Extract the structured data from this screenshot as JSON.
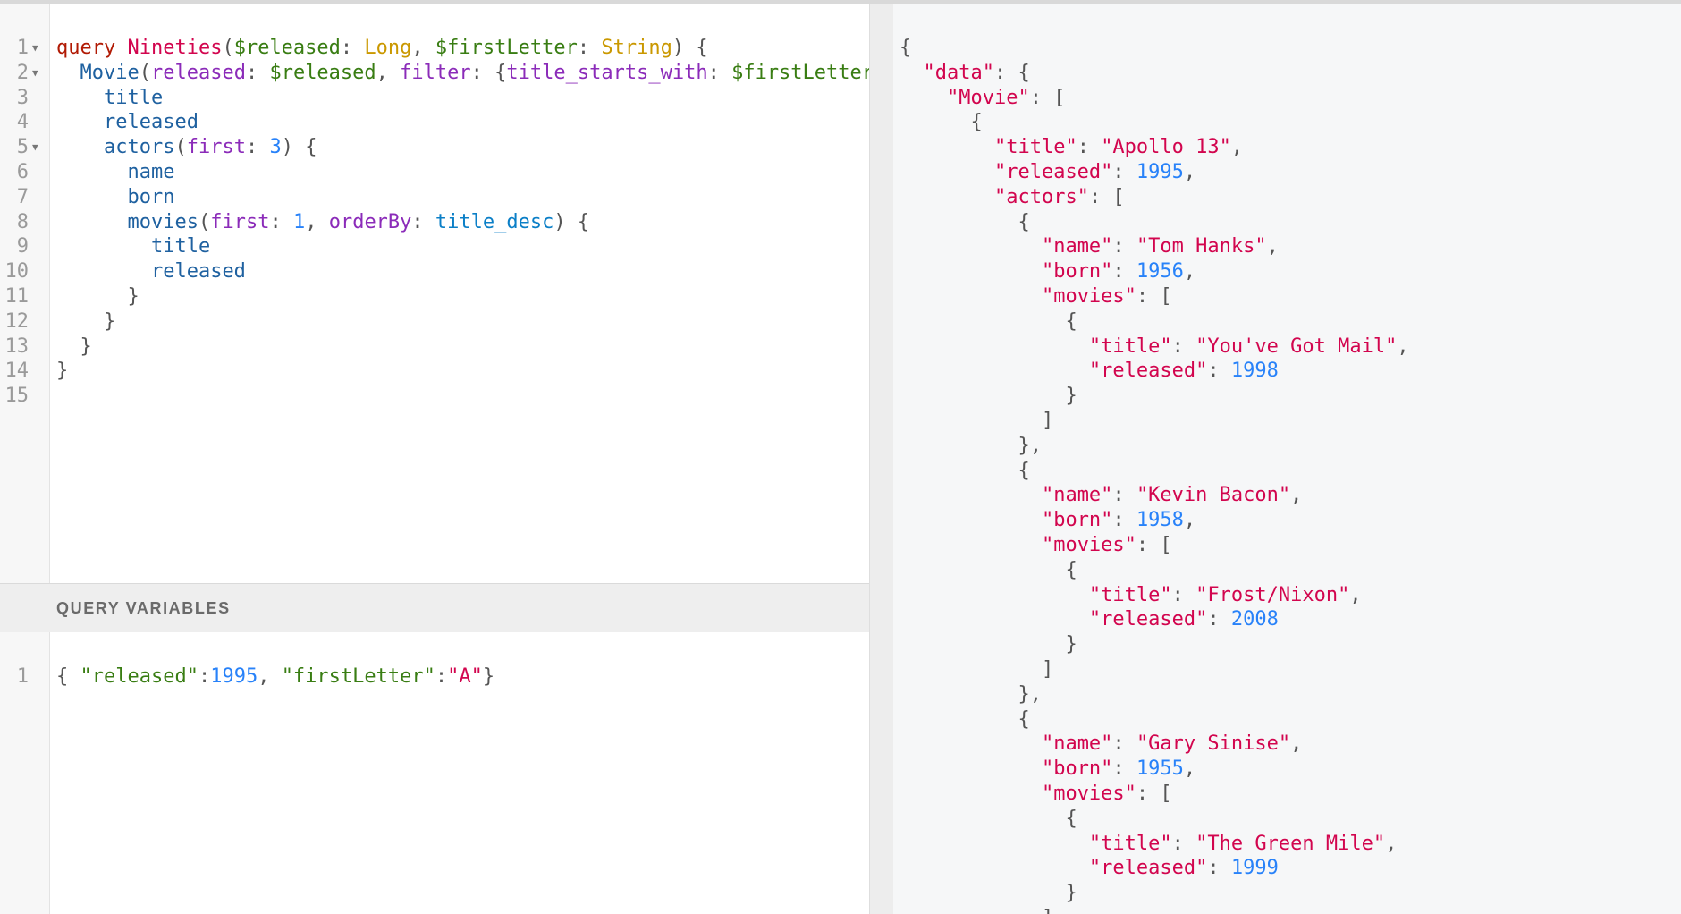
{
  "editor": {
    "lines": [
      {
        "n": "1",
        "fold": true
      },
      {
        "n": "2",
        "fold": true
      },
      {
        "n": "3"
      },
      {
        "n": "4"
      },
      {
        "n": "5",
        "fold": true
      },
      {
        "n": "6"
      },
      {
        "n": "7"
      },
      {
        "n": "8"
      },
      {
        "n": "9"
      },
      {
        "n": "10"
      },
      {
        "n": "11"
      },
      {
        "n": "12"
      },
      {
        "n": "13"
      },
      {
        "n": "14"
      },
      {
        "n": "15"
      }
    ],
    "tokens": {
      "l1_kw": "query",
      "l1_name": "Nineties",
      "l1_p1": "(",
      "l1_v1": "$released",
      "l1_c1": ": ",
      "l1_t1": "Long",
      "l1_cm": ", ",
      "l1_v2": "$firstLetter",
      "l1_c2": ": ",
      "l1_t2": "String",
      "l1_end": ") {",
      "l2_f": "Movie",
      "l2_p": "(",
      "l2_a1": "released",
      "l2_c1": ": ",
      "l2_v1": "$released",
      "l2_cm": ", ",
      "l2_a2": "filter",
      "l2_c2": ": {",
      "l2_a3": "title_starts_with",
      "l2_c3": ": ",
      "l2_v2": "$firstLetter",
      "l3_f": "title",
      "l4_f": "released",
      "l5_f": "actors",
      "l5_p": "(",
      "l5_a": "first",
      "l5_c": ": ",
      "l5_n": "3",
      "l5_end": ") {",
      "l6_f": "name",
      "l7_f": "born",
      "l8_f": "movies",
      "l8_p": "(",
      "l8_a1": "first",
      "l8_c1": ": ",
      "l8_n": "1",
      "l8_cm": ", ",
      "l8_a2": "orderBy",
      "l8_c2": ": ",
      "l8_e": "title_desc",
      "l8_end": ") {",
      "l9_f": "title",
      "l10_f": "released",
      "l11": "}",
      "l12": "}",
      "l13": "}",
      "l14": "}"
    }
  },
  "variables": {
    "header": "QUERY VARIABLES",
    "line_number": "1",
    "tokens": {
      "open": "{ ",
      "k1": "\"released\"",
      "c1": ":",
      "v1": "1995",
      "cm": ", ",
      "k2": "\"firstLetter\"",
      "c2": ":",
      "v2": "\"A\"",
      "close": "}"
    }
  },
  "result": {
    "lines": [
      {
        "indent": 0,
        "tokens": [
          {
            "t": "{",
            "c": "jpun"
          }
        ]
      },
      {
        "indent": 1,
        "tokens": [
          {
            "t": "\"data\"",
            "c": "jkey"
          },
          {
            "t": ": {",
            "c": "jpun"
          }
        ]
      },
      {
        "indent": 2,
        "tokens": [
          {
            "t": "\"Movie\"",
            "c": "jkey"
          },
          {
            "t": ": [",
            "c": "jpun"
          }
        ]
      },
      {
        "indent": 3,
        "tokens": [
          {
            "t": "{",
            "c": "jpun"
          }
        ]
      },
      {
        "indent": 4,
        "tokens": [
          {
            "t": "\"title\"",
            "c": "jkey"
          },
          {
            "t": ": ",
            "c": "jpun"
          },
          {
            "t": "\"Apollo 13\"",
            "c": "jstr"
          },
          {
            "t": ",",
            "c": "jpun"
          }
        ]
      },
      {
        "indent": 4,
        "tokens": [
          {
            "t": "\"released\"",
            "c": "jkey"
          },
          {
            "t": ": ",
            "c": "jpun"
          },
          {
            "t": "1995",
            "c": "jnum"
          },
          {
            "t": ",",
            "c": "jpun"
          }
        ]
      },
      {
        "indent": 4,
        "tokens": [
          {
            "t": "\"actors\"",
            "c": "jkey"
          },
          {
            "t": ": [",
            "c": "jpun"
          }
        ]
      },
      {
        "indent": 5,
        "tokens": [
          {
            "t": "{",
            "c": "jpun"
          }
        ]
      },
      {
        "indent": 6,
        "tokens": [
          {
            "t": "\"name\"",
            "c": "jkey"
          },
          {
            "t": ": ",
            "c": "jpun"
          },
          {
            "t": "\"Tom Hanks\"",
            "c": "jstr"
          },
          {
            "t": ",",
            "c": "jpun"
          }
        ]
      },
      {
        "indent": 6,
        "tokens": [
          {
            "t": "\"born\"",
            "c": "jkey"
          },
          {
            "t": ": ",
            "c": "jpun"
          },
          {
            "t": "1956",
            "c": "jnum"
          },
          {
            "t": ",",
            "c": "jpun"
          }
        ]
      },
      {
        "indent": 6,
        "tokens": [
          {
            "t": "\"movies\"",
            "c": "jkey"
          },
          {
            "t": ": [",
            "c": "jpun"
          }
        ]
      },
      {
        "indent": 7,
        "tokens": [
          {
            "t": "{",
            "c": "jpun"
          }
        ]
      },
      {
        "indent": 8,
        "tokens": [
          {
            "t": "\"title\"",
            "c": "jkey"
          },
          {
            "t": ": ",
            "c": "jpun"
          },
          {
            "t": "\"You've Got Mail\"",
            "c": "jstr"
          },
          {
            "t": ",",
            "c": "jpun"
          }
        ]
      },
      {
        "indent": 8,
        "tokens": [
          {
            "t": "\"released\"",
            "c": "jkey"
          },
          {
            "t": ": ",
            "c": "jpun"
          },
          {
            "t": "1998",
            "c": "jnum"
          }
        ]
      },
      {
        "indent": 7,
        "tokens": [
          {
            "t": "}",
            "c": "jpun"
          }
        ]
      },
      {
        "indent": 6,
        "tokens": [
          {
            "t": "]",
            "c": "jpun"
          }
        ]
      },
      {
        "indent": 5,
        "tokens": [
          {
            "t": "},",
            "c": "jpun"
          }
        ]
      },
      {
        "indent": 5,
        "tokens": [
          {
            "t": "{",
            "c": "jpun"
          }
        ]
      },
      {
        "indent": 6,
        "tokens": [
          {
            "t": "\"name\"",
            "c": "jkey"
          },
          {
            "t": ": ",
            "c": "jpun"
          },
          {
            "t": "\"Kevin Bacon\"",
            "c": "jstr"
          },
          {
            "t": ",",
            "c": "jpun"
          }
        ]
      },
      {
        "indent": 6,
        "tokens": [
          {
            "t": "\"born\"",
            "c": "jkey"
          },
          {
            "t": ": ",
            "c": "jpun"
          },
          {
            "t": "1958",
            "c": "jnum"
          },
          {
            "t": ",",
            "c": "jpun"
          }
        ]
      },
      {
        "indent": 6,
        "tokens": [
          {
            "t": "\"movies\"",
            "c": "jkey"
          },
          {
            "t": ": [",
            "c": "jpun"
          }
        ]
      },
      {
        "indent": 7,
        "tokens": [
          {
            "t": "{",
            "c": "jpun"
          }
        ]
      },
      {
        "indent": 8,
        "tokens": [
          {
            "t": "\"title\"",
            "c": "jkey"
          },
          {
            "t": ": ",
            "c": "jpun"
          },
          {
            "t": "\"Frost/Nixon\"",
            "c": "jstr"
          },
          {
            "t": ",",
            "c": "jpun"
          }
        ]
      },
      {
        "indent": 8,
        "tokens": [
          {
            "t": "\"released\"",
            "c": "jkey"
          },
          {
            "t": ": ",
            "c": "jpun"
          },
          {
            "t": "2008",
            "c": "jnum"
          }
        ]
      },
      {
        "indent": 7,
        "tokens": [
          {
            "t": "}",
            "c": "jpun"
          }
        ]
      },
      {
        "indent": 6,
        "tokens": [
          {
            "t": "]",
            "c": "jpun"
          }
        ]
      },
      {
        "indent": 5,
        "tokens": [
          {
            "t": "},",
            "c": "jpun"
          }
        ]
      },
      {
        "indent": 5,
        "tokens": [
          {
            "t": "{",
            "c": "jpun"
          }
        ]
      },
      {
        "indent": 6,
        "tokens": [
          {
            "t": "\"name\"",
            "c": "jkey"
          },
          {
            "t": ": ",
            "c": "jpun"
          },
          {
            "t": "\"Gary Sinise\"",
            "c": "jstr"
          },
          {
            "t": ",",
            "c": "jpun"
          }
        ]
      },
      {
        "indent": 6,
        "tokens": [
          {
            "t": "\"born\"",
            "c": "jkey"
          },
          {
            "t": ": ",
            "c": "jpun"
          },
          {
            "t": "1955",
            "c": "jnum"
          },
          {
            "t": ",",
            "c": "jpun"
          }
        ]
      },
      {
        "indent": 6,
        "tokens": [
          {
            "t": "\"movies\"",
            "c": "jkey"
          },
          {
            "t": ": [",
            "c": "jpun"
          }
        ]
      },
      {
        "indent": 7,
        "tokens": [
          {
            "t": "{",
            "c": "jpun"
          }
        ]
      },
      {
        "indent": 8,
        "tokens": [
          {
            "t": "\"title\"",
            "c": "jkey"
          },
          {
            "t": ": ",
            "c": "jpun"
          },
          {
            "t": "\"The Green Mile\"",
            "c": "jstr"
          },
          {
            "t": ",",
            "c": "jpun"
          }
        ]
      },
      {
        "indent": 8,
        "tokens": [
          {
            "t": "\"released\"",
            "c": "jkey"
          },
          {
            "t": ": ",
            "c": "jpun"
          },
          {
            "t": "1999",
            "c": "jnum"
          }
        ]
      },
      {
        "indent": 7,
        "tokens": [
          {
            "t": "}",
            "c": "jpun"
          }
        ]
      },
      {
        "indent": 6,
        "tokens": [
          {
            "t": "]",
            "c": "jpun"
          }
        ]
      }
    ],
    "fold_markers_at_lines": [
      0,
      1,
      2,
      3,
      6,
      7,
      10,
      17,
      20,
      27,
      30
    ]
  }
}
